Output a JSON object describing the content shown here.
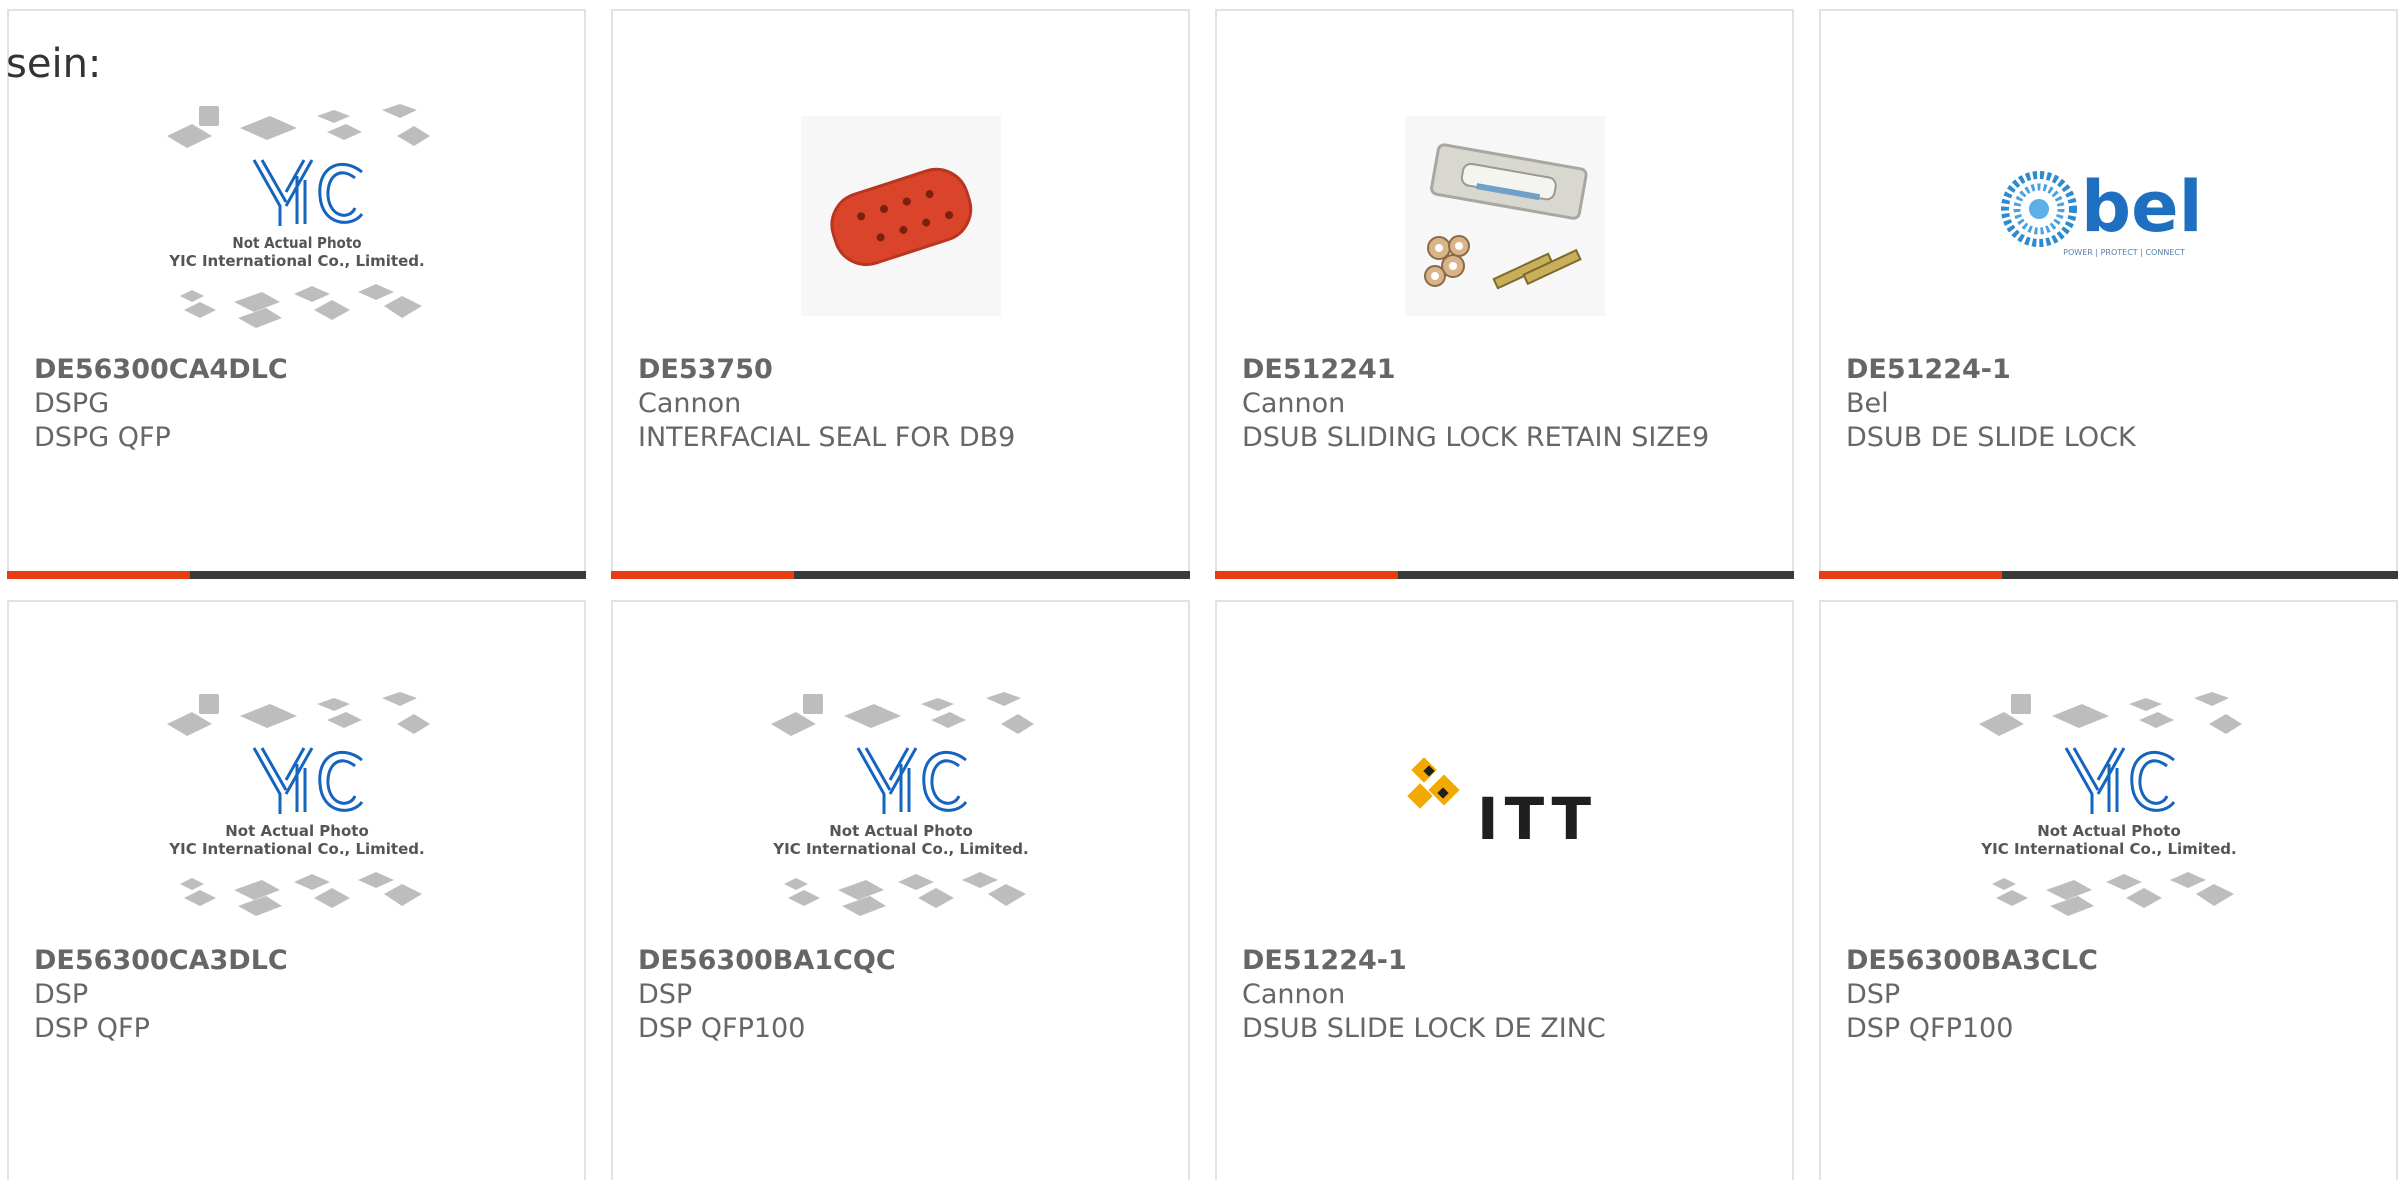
{
  "intro_text": "sein:",
  "accent_color": "#e63e12",
  "bar_color": "#3a3a3a",
  "products": [
    {
      "part_number": "DE56300CA4DLC",
      "manufacturer": "DSPG",
      "description": "DSPG QFP",
      "image": {
        "type": "placeholder",
        "line1": "Not Actual Photo",
        "line2": "YIC International Co., Limited."
      }
    },
    {
      "part_number": "DE53750",
      "manufacturer": "Cannon",
      "description": "INTERFACIAL SEAL FOR DB9",
      "image": {
        "type": "red-seal-photo"
      }
    },
    {
      "part_number": "DE512241",
      "manufacturer": "Cannon",
      "description": "DSUB SLIDING LOCK RETAIN SIZE9",
      "image": {
        "type": "slide-lock-hardware-photo"
      }
    },
    {
      "part_number": "DE51224-1",
      "manufacturer": "Bel",
      "description": "DSUB DE SLIDE LOCK",
      "image": {
        "type": "bel-logo",
        "logo_text": "bel",
        "tagline": "POWER | PROTECT | CONNECT"
      }
    },
    {
      "part_number": "DE56300CA3DLC",
      "manufacturer": "DSP",
      "description": "DSP QFP",
      "image": {
        "type": "placeholder",
        "line1": "Not Actual Photo",
        "line2": "YIC International Co., Limited."
      }
    },
    {
      "part_number": "DE56300BA1CQC",
      "manufacturer": "DSP",
      "description": "DSP QFP100",
      "image": {
        "type": "placeholder",
        "line1": "Not Actual Photo",
        "line2": "YIC International Co., Limited."
      }
    },
    {
      "part_number": "DE51224-1",
      "manufacturer": "Cannon",
      "description": "DSUB SLIDE LOCK DE ZINC",
      "image": {
        "type": "itt-logo",
        "logo_text": "ITT"
      }
    },
    {
      "part_number": "DE56300BA3CLC",
      "manufacturer": "DSP",
      "description": "DSP QFP100",
      "image": {
        "type": "placeholder",
        "line1": "Not Actual Photo",
        "line2": "YIC International Co., Limited."
      }
    }
  ]
}
